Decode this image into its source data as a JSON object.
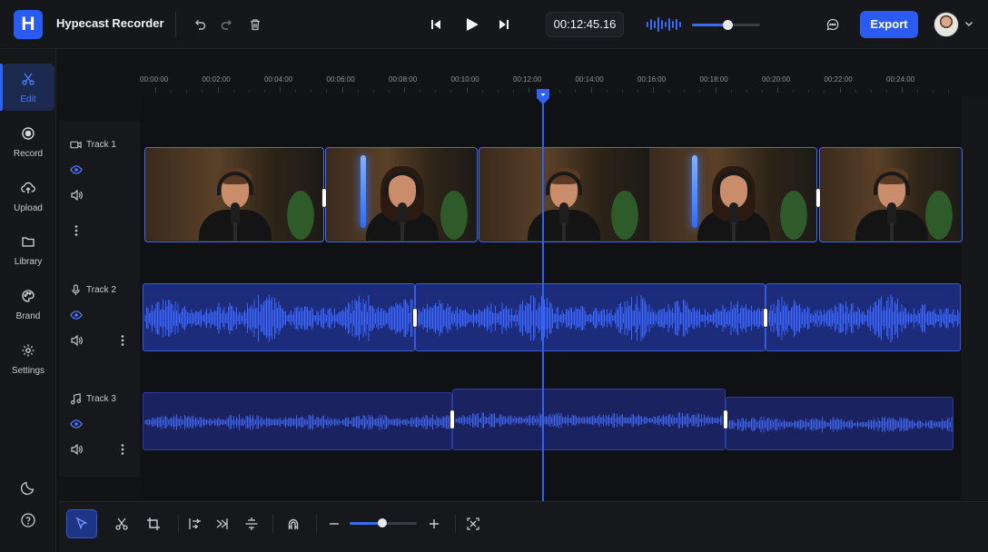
{
  "app": {
    "logo_letter": "H",
    "title": "Hypecast Recorder"
  },
  "toolbar": {
    "timecode": "00:12:45.16",
    "volume_level": 0.52,
    "export_label": "Export",
    "icons": [
      "undo-icon",
      "redo-icon",
      "trash-icon",
      "skip-back-icon",
      "play-icon",
      "skip-forward-icon",
      "waveform-icon",
      "comment-icon",
      "chevron-down-icon"
    ]
  },
  "sidebar": {
    "items": [
      {
        "label": "Edit",
        "icon": "scissors-icon",
        "active": true
      },
      {
        "label": "Record",
        "icon": "record-icon",
        "active": false
      },
      {
        "label": "Upload",
        "icon": "cloud-upload-icon",
        "active": false
      },
      {
        "label": "Library",
        "icon": "folder-icon",
        "active": false
      },
      {
        "label": "Brand",
        "icon": "palette-icon",
        "active": false
      },
      {
        "label": "Settings",
        "icon": "gear-icon",
        "active": false
      }
    ],
    "bottom_icons": [
      "moon-icon",
      "help-icon"
    ]
  },
  "ruler": {
    "labels": [
      "00:00:00",
      "00:02:00",
      "00:04:00",
      "00:06:00",
      "00:08:00",
      "00:10:00",
      "00:12:00",
      "00:14:00",
      "00:16:00",
      "00:18:00",
      "00:20:00",
      "00:22:00",
      "00:24:00"
    ]
  },
  "tracks": [
    {
      "name": "Track 1",
      "type": "video",
      "icon": "video-camera-icon"
    },
    {
      "name": "Track 2",
      "type": "audio",
      "icon": "microphone-icon"
    },
    {
      "name": "Track 3",
      "type": "music",
      "icon": "music-note-icon"
    }
  ],
  "bottom_toolbar": {
    "tools": [
      "select-tool-icon",
      "cut-icon",
      "crop-icon",
      "align-left-icon",
      "trim-icon",
      "split-icon",
      "magnet-icon",
      "zoom-out-icon",
      "zoom-in-icon",
      "fit-icon"
    ],
    "zoom_level": 0.48
  },
  "colors": {
    "accent": "#2a5bf0",
    "background": "#121316",
    "audio_clip": "#1d2c7a"
  }
}
